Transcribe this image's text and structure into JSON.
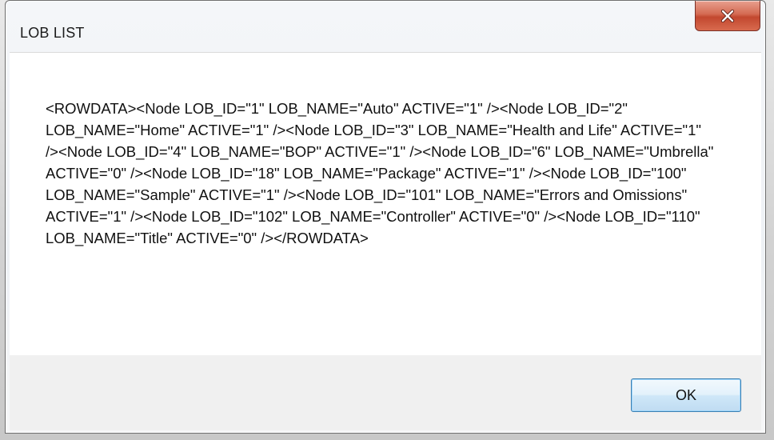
{
  "window": {
    "title": "LOB LIST"
  },
  "message": {
    "text": "<ROWDATA><Node LOB_ID=\"1\" LOB_NAME=\"Auto\" ACTIVE=\"1\" /><Node LOB_ID=\"2\" LOB_NAME=\"Home\" ACTIVE=\"1\" /><Node LOB_ID=\"3\" LOB_NAME=\"Health and Life\" ACTIVE=\"1\" /><Node LOB_ID=\"4\" LOB_NAME=\"BOP\" ACTIVE=\"1\" /><Node LOB_ID=\"6\" LOB_NAME=\"Umbrella\" ACTIVE=\"0\" /><Node LOB_ID=\"18\" LOB_NAME=\"Package\" ACTIVE=\"1\" /><Node LOB_ID=\"100\" LOB_NAME=\"Sample\" ACTIVE=\"1\" /><Node LOB_ID=\"101\" LOB_NAME=\"Errors and Omissions\" ACTIVE=\"1\" /><Node LOB_ID=\"102\" LOB_NAME=\"Controller\" ACTIVE=\"0\" /><Node LOB_ID=\"110\" LOB_NAME=\"Title\" ACTIVE=\"0\" /></ROWDATA>"
  },
  "buttons": {
    "ok_label": "OK",
    "close_icon": "close-icon"
  },
  "colors": {
    "close_button": "#c7482f",
    "ok_border": "#3c7fb1",
    "content_bg": "#ffffff",
    "footer_bg": "#f0f0f0"
  }
}
